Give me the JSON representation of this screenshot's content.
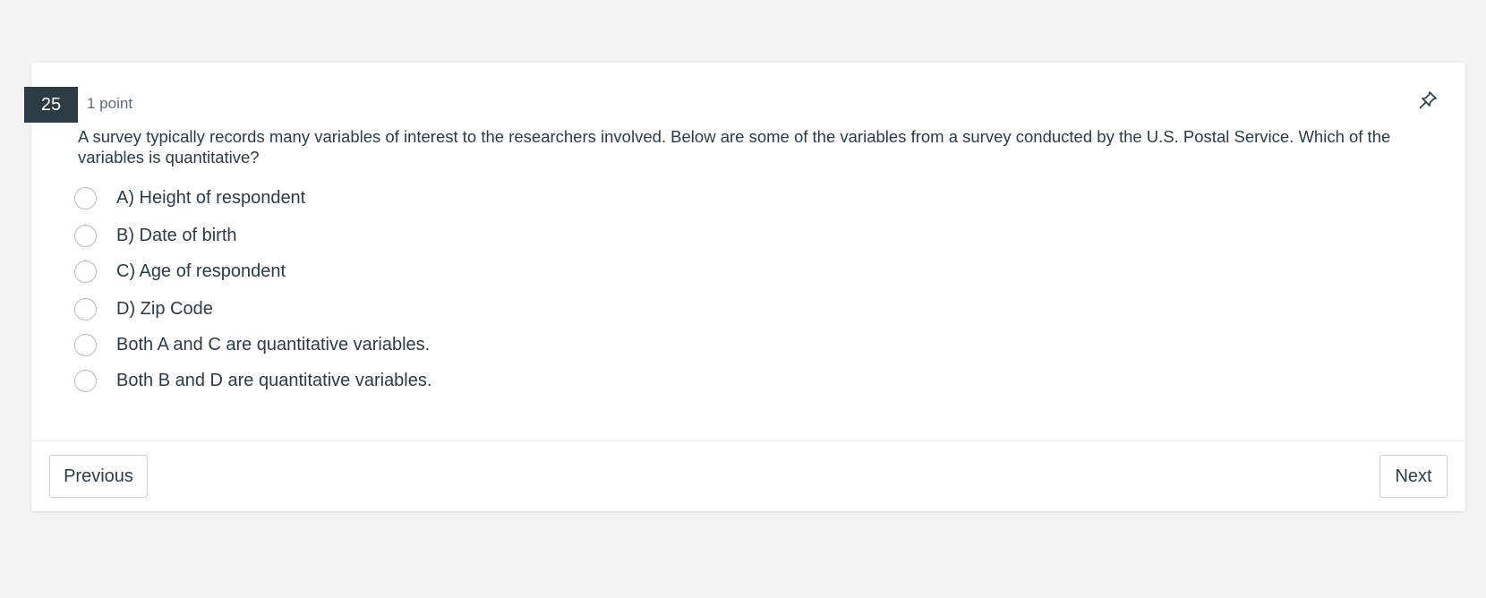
{
  "question": {
    "number": "25",
    "points": "1 point",
    "text": "A survey typically records many variables of interest to the researchers involved. Below are some of the variables from a survey conducted by the U.S. Postal Service. Which of the variables is quantitative?",
    "options": [
      {
        "label": "A) Height of respondent"
      },
      {
        "label": "B) Date of birth"
      },
      {
        "label": "C) Age of respondent"
      },
      {
        "label": "D) Zip Code"
      },
      {
        "label": "Both A and C are quantitative variables."
      },
      {
        "label": "Both B and D are quantitative variables."
      }
    ],
    "pin_icon": "pin-icon"
  },
  "nav": {
    "previous_label": "Previous",
    "next_label": "Next"
  },
  "colors": {
    "badge_bg": "#2d3b45",
    "text": "#2d3b45",
    "page_bg": "#f4f4f4"
  }
}
